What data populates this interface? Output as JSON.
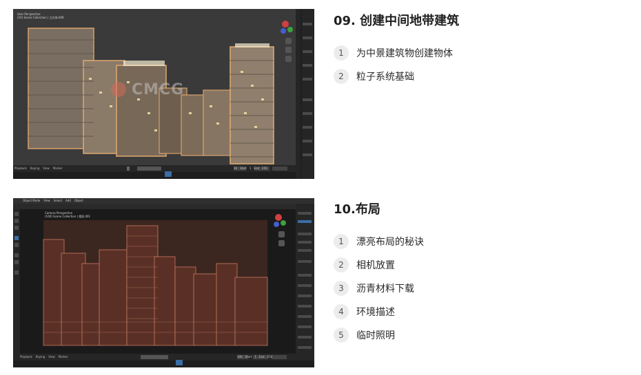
{
  "sections": [
    {
      "title": "09. 创建中间地带建筑",
      "lessons": [
        {
          "num": "1",
          "title": "为中景建筑物创建物体"
        },
        {
          "num": "2",
          "title": "粒子系统基础"
        }
      ],
      "screenshot": {
        "viewport_label": "User Perspective",
        "collection_label": "(16) Scene Collection | 立方体.009",
        "watermark": "CMCG",
        "timeline_menu": [
          "Playback",
          "Keying",
          "View",
          "Marker"
        ],
        "start_label": "Start",
        "start_value": "1",
        "end_label": "End",
        "end_value": "250",
        "frame_value": "16"
      }
    },
    {
      "title": "10.布局",
      "lessons": [
        {
          "num": "1",
          "title": "漂亮布局的秘诀"
        },
        {
          "num": "2",
          "title": "相机放置"
        },
        {
          "num": "3",
          "title": "沥青材料下载"
        },
        {
          "num": "4",
          "title": "环境描述"
        },
        {
          "num": "5",
          "title": "临时照明"
        }
      ],
      "screenshot": {
        "mode_menu": [
          "Object Mode",
          "View",
          "Select",
          "Add",
          "Object"
        ],
        "viewport_label": "Camera Perspective",
        "collection_label": "(100) Scene Collection | 相机.001",
        "timeline_menu": [
          "Playback",
          "Keying",
          "View",
          "Marker"
        ],
        "start_label": "Start",
        "start_value": "1",
        "end_label": "End",
        "end_value": "250",
        "frame_value": "100"
      }
    }
  ]
}
